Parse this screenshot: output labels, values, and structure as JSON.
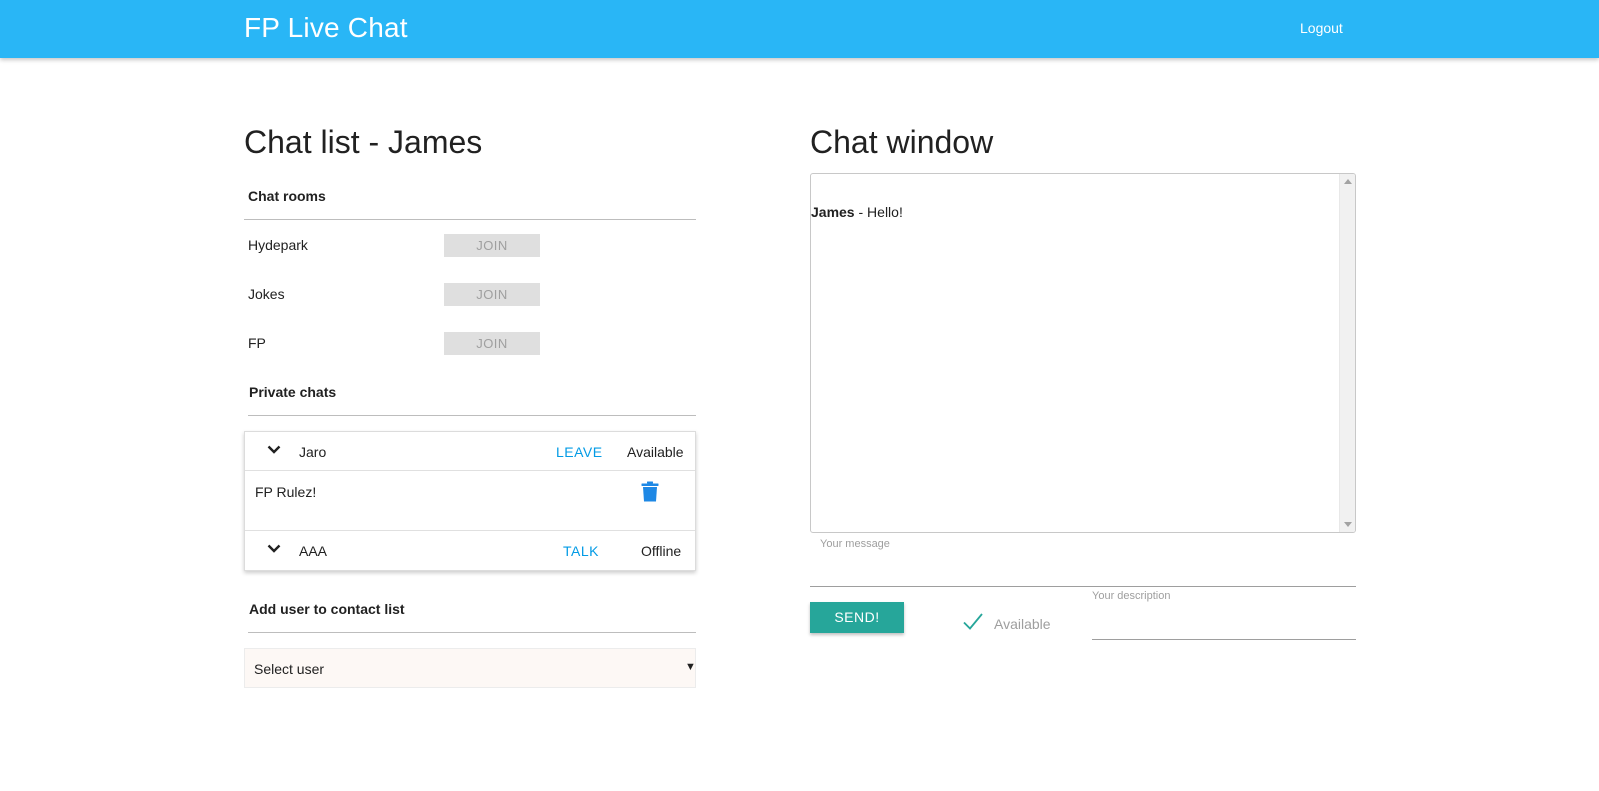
{
  "navbar": {
    "brand": "FP Live Chat",
    "logout_label": "Logout"
  },
  "chat_list": {
    "title": "Chat list - James",
    "rooms_label": "Chat rooms",
    "rooms": [
      {
        "name": "Hydepark",
        "button": "JOIN"
      },
      {
        "name": "Jokes",
        "button": "JOIN"
      },
      {
        "name": "FP",
        "button": "JOIN"
      }
    ],
    "private_label": "Private chats",
    "private_chats": [
      {
        "name": "Jaro",
        "action": "LEAVE",
        "status": "Available",
        "expanded": true,
        "body": "FP Rulez!"
      },
      {
        "name": "AAA",
        "action": "TALK",
        "status": "Offline",
        "expanded": false
      }
    ],
    "add_user_label": "Add user to contact list",
    "select_user": {
      "value": "Select user"
    }
  },
  "chat_window": {
    "title": "Chat window",
    "messages": [
      {
        "author": "James",
        "separator": " - ",
        "text": "Hello!"
      }
    ],
    "message_label": "Your message",
    "send_label": "SEND!",
    "available_label": "Available",
    "available_checked": true,
    "description_label": "Your description"
  },
  "colors": {
    "navbar": "#29b6f6",
    "link": "#039be5",
    "send_button": "#26a69a",
    "join_button_bg": "#dfdfdf"
  }
}
